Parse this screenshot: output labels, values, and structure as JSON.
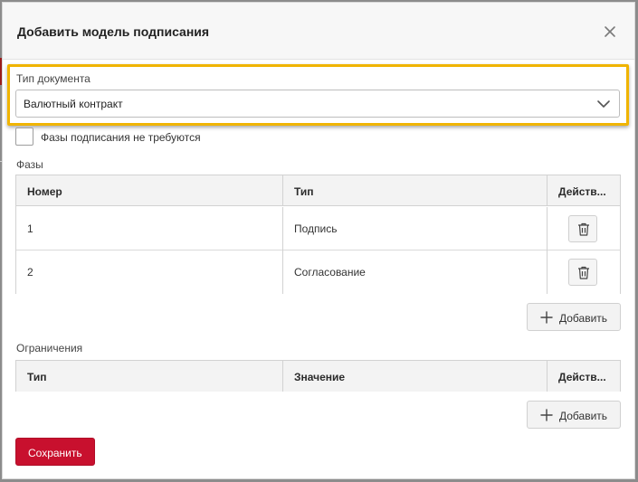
{
  "dialog": {
    "title": "Добавить модель подписания"
  },
  "document_type": {
    "label": "Тип документа",
    "value": "Валютный контракт"
  },
  "no_phases_checkbox": {
    "label": "Фазы подписания не требуются",
    "checked": false
  },
  "phases": {
    "label": "Фазы",
    "columns": [
      "Номер",
      "Тип",
      "Действ..."
    ],
    "rows": [
      {
        "number": "1",
        "type": "Подпись"
      },
      {
        "number": "2",
        "type": "Согласование"
      }
    ],
    "add_label": "Добавить"
  },
  "restrictions": {
    "label": "Ограничения",
    "columns": [
      "Тип",
      "Значение",
      "Действ..."
    ],
    "add_label": "Добавить"
  },
  "save_label": "Сохранить",
  "colors": {
    "accent": "#c8102e",
    "highlight": "#f0b400"
  },
  "icons": {
    "close": "close-icon",
    "dropdown": "chevron-down-icon",
    "delete": "trash-icon",
    "add": "plus-icon"
  }
}
